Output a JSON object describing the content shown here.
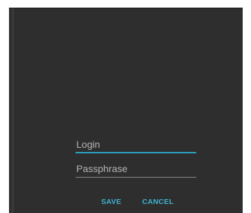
{
  "form": {
    "login_placeholder": "Login",
    "passphrase_placeholder": "Passphrase"
  },
  "actions": {
    "save_label": "SAVE",
    "cancel_label": "CANCEL"
  },
  "colors": {
    "background": "#2e2e2e",
    "accent": "#2aa6c6"
  }
}
